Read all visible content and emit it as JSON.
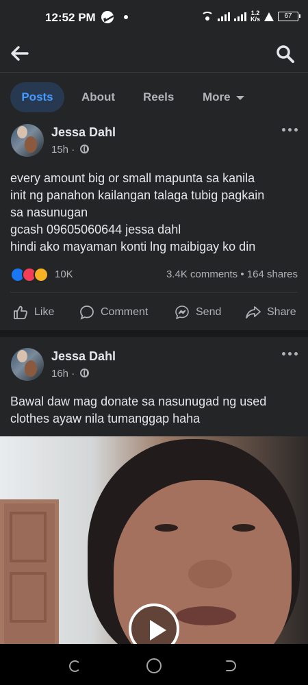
{
  "status_bar": {
    "time": "12:52 PM",
    "network_speed_value": "1.2",
    "network_speed_unit": "K/s",
    "battery": "67",
    "icons": [
      "messenger-icon",
      "dot-icon",
      "wifi-icon",
      "signal-icon",
      "warning-icon",
      "battery-icon"
    ]
  },
  "top_bar": {
    "back_icon": "arrow-left-icon",
    "search_icon": "search-icon"
  },
  "tabs": [
    {
      "label": "Posts",
      "active": true
    },
    {
      "label": "About",
      "active": false
    },
    {
      "label": "Reels",
      "active": false
    },
    {
      "label": "More",
      "active": false,
      "icon": "chevron-down-icon"
    }
  ],
  "posts": [
    {
      "author": "Jessa Dahl",
      "time": "15h",
      "visibility_icon": "globe-icon",
      "text_lines": [
        "every amount big or small mapunta sa kanila",
        "init ng panahon kailangan talaga tubig pagkain",
        "sa nasunugan",
        "gcash 09605060644 jessa dahl",
        "hindi ako mayaman konti lng maibigay ko din"
      ],
      "reaction_icons": [
        "like-reaction-icon",
        "love-reaction-icon",
        "care-reaction-icon"
      ],
      "reaction_count": "10K",
      "comments_count": "3.4K comments",
      "shares_count": "164 shares",
      "actions": [
        "Like",
        "Comment",
        "Send",
        "Share"
      ]
    },
    {
      "author": "Jessa Dahl",
      "time": "16h",
      "visibility_icon": "globe-icon",
      "text_lines": [
        "Bawal daw mag donate sa nasunugad ng used",
        "clothes ayaw nila tumanggap haha"
      ],
      "video_icon": "play-icon"
    }
  ],
  "colors": {
    "background": "#18191a",
    "surface": "#242526",
    "active_tab": "#263951",
    "active_tab_text": "#4599ff",
    "primary_text": "#e4e6eb",
    "secondary_text": "#b0b3b8"
  },
  "nav_bar": {
    "icons": [
      "recent-apps-icon",
      "home-icon",
      "back-icon"
    ]
  }
}
